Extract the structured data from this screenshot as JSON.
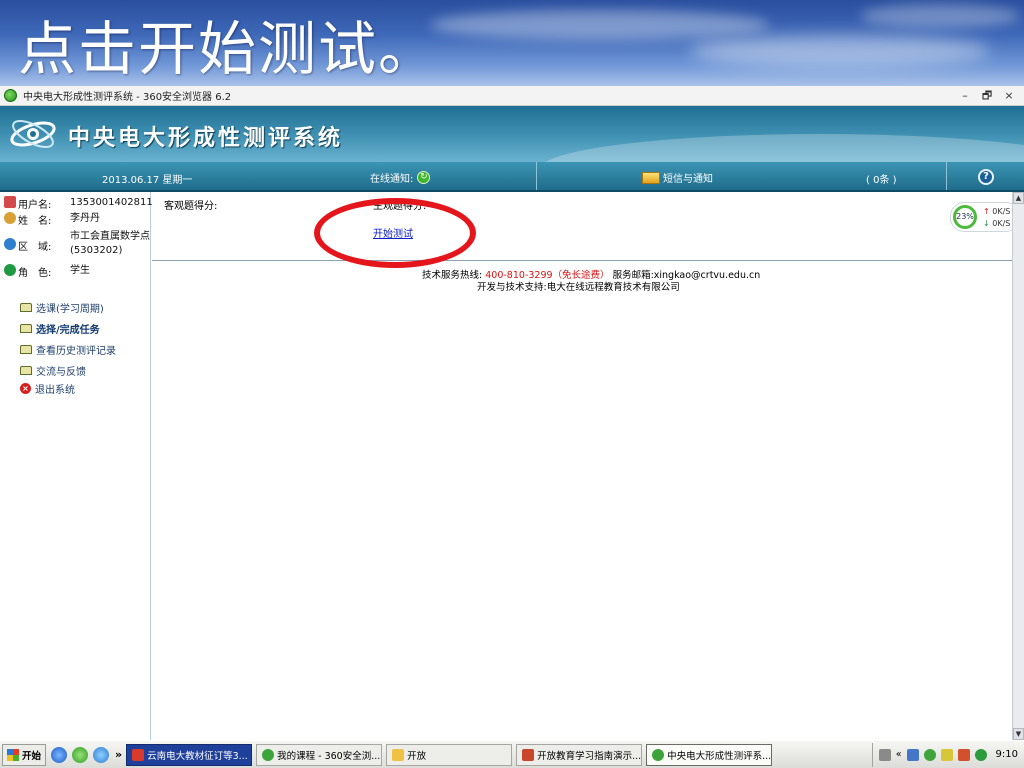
{
  "slide": {
    "title": "点击开始测试。"
  },
  "browser": {
    "title": "中央电大形成性测评系统 - 360安全浏览器 6.2",
    "min_label": "–",
    "restore_label": "🗗",
    "close_label": "×"
  },
  "app": {
    "title": "中央电大形成性测评系统"
  },
  "navbar": {
    "date": "2013.06.17 星期一",
    "online_notice": "在线通知:",
    "sms_notice": "短信与通知",
    "count": "( 0条 )",
    "help_label": "?"
  },
  "user": {
    "username_label": "用户名:",
    "username": "1353001402811",
    "name_label": "姓　名:",
    "name": "李丹丹",
    "district_label": "区　域:",
    "district": "市工会直属数学点(5303202)",
    "role_label": "角　色:",
    "role": "学生"
  },
  "menu": [
    {
      "label": "选课(学习周期)"
    },
    {
      "label": "选择/完成任务"
    },
    {
      "label": "查看历史测评记录"
    },
    {
      "label": "交流与反馈"
    },
    {
      "label": "退出系统"
    }
  ],
  "content": {
    "objective_score_label": "客观题得分:",
    "subjective_score_label": "主观题得分:",
    "start_test_link": "开始测试",
    "footer_service_prefix": "技术服务热线:",
    "footer_hotline": "400-810-3299（免长途费）",
    "footer_email": "服务邮箱:xingkao@crtvu.edu.cn",
    "footer_support": "开发与技术支持:电大在线远程教育技术有限公司"
  },
  "speed_widget": {
    "percent": "23%",
    "up": "0K/S",
    "down": "0K/S"
  },
  "taskbar": {
    "start_label": "开始",
    "chevron": "»",
    "tasks": [
      {
        "label": "云南电大教材征订等3..."
      },
      {
        "label": "我的课程 - 360安全浏..."
      },
      {
        "label": "开放"
      },
      {
        "label": "开放教育学习指南演示..."
      },
      {
        "label": "中央电大形成性测评系..."
      }
    ],
    "tray_chevron": "«",
    "clock": "9:10"
  },
  "colors": {
    "header": "#1e6f93",
    "navbar": "#1f6c8c",
    "highlight_oval": "#e4161b",
    "link": "#1020c8",
    "hotline": "#dd1111"
  }
}
